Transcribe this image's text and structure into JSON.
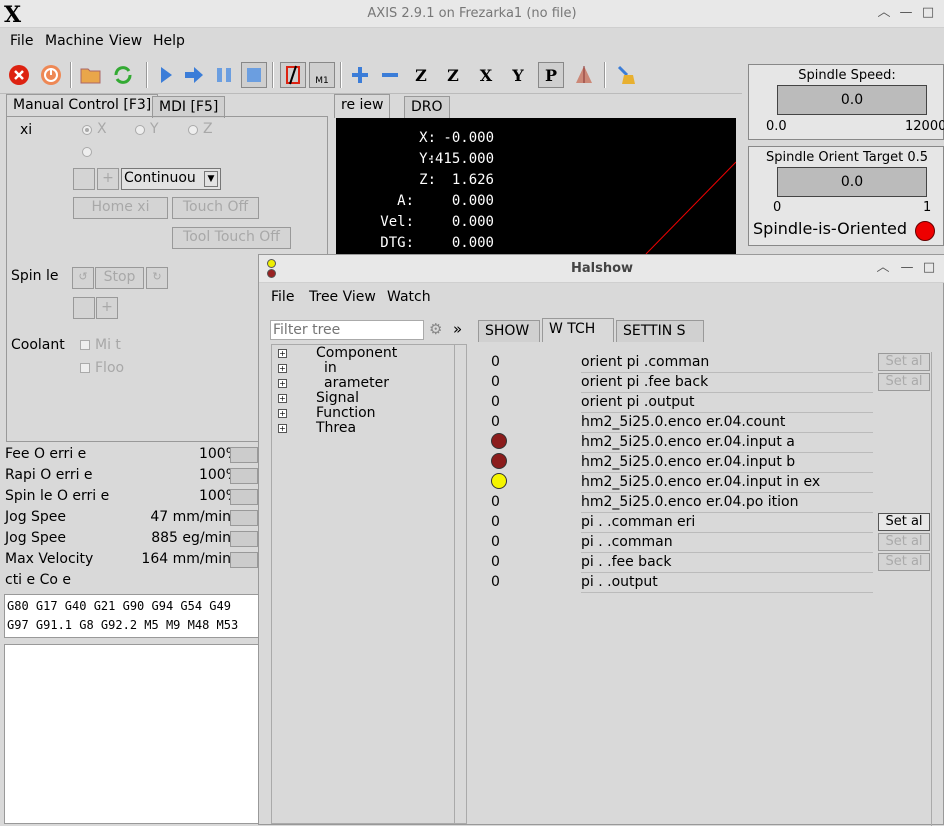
{
  "window": {
    "title": "AXIS 2.9.1 on Frezarka1 (no file)",
    "logo": "X"
  },
  "menu": [
    "File",
    "Machine",
    "View",
    "Help"
  ],
  "toolbar": {
    "icons": [
      "estop-icon",
      "power-icon",
      "open-icon",
      "reload-icon",
      "run-icon",
      "step-icon",
      "pause-icon",
      "stop-icon",
      "block-delete-icon",
      "optional-stop-icon",
      "zoom-in-icon",
      "zoom-out-icon",
      "view-z-icon",
      "view-z2-icon",
      "view-x-icon",
      "view-y-icon",
      "view-p-icon",
      "rotate-icon",
      "clear-icon"
    ],
    "optional_stop_label": "M1"
  },
  "tabs_left": [
    "Manual Control [F3]",
    "MDI [F5]"
  ],
  "manual": {
    "axis_label": "xi",
    "axes": [
      "X",
      "Y",
      "Z"
    ],
    "minus": "",
    "plus": "+",
    "jog_mode": "Continuou",
    "home_label": "Home   xi",
    "touch_off": "Touch Off",
    "tool_touch_off": "Tool Touch Off",
    "spindle_label": "Spin  le",
    "stop_label": "Stop",
    "coolant_label": "Coolant",
    "mist": "Mi  t",
    "flood": "Floo"
  },
  "overrides": [
    {
      "label": "Fee   O  erri   e",
      "value": "100%"
    },
    {
      "label": "Rapi   O  erri   e",
      "value": "100%"
    },
    {
      "label": "Spin  le O  erri   e",
      "value": "100%"
    },
    {
      "label": "Jog Spee",
      "value": "47 mm/min"
    },
    {
      "label": "Jog Spee",
      "value": "885   eg/min"
    },
    {
      "label": "Max Velocity",
      "value": "164 mm/min"
    }
  ],
  "active_codes": {
    "label": " cti  e    Co  e",
    "line1": "G80 G17 G40 G21 G90 G94 G54 G49",
    "line2": "G97 G91.1 G8 G92.2 M5 M9 M48 M53"
  },
  "tabs_view": [
    "re  iew",
    "DRO"
  ],
  "dro": [
    {
      "axis": "X:",
      "value": "-0.000"
    },
    {
      "axis": "Y:",
      "value": "-415.000"
    },
    {
      "axis": "Z:",
      "value": "1.626"
    },
    {
      "axis": "A:",
      "value": "0.000"
    },
    {
      "axis": "Vel:",
      "value": "0.000"
    },
    {
      "axis": "DTG:",
      "value": "0.000"
    }
  ],
  "spindle_speed": {
    "title": "Spindle Speed:",
    "value": "0.0",
    "min": "0.0",
    "max": "12000"
  },
  "spindle_orient": {
    "title": "Spindle Orient Target 0.5",
    "value": "0.0",
    "min": "0",
    "max": "1",
    "oriented_label": "Spindle-is-Oriented",
    "led_color": "#ee0000"
  },
  "halshow": {
    "title": "Halshow",
    "menu": [
      "File",
      "Tree View",
      "Watch"
    ],
    "filter_placeholder": "Filter tree",
    "more": "»",
    "tabs": [
      "SHOW",
      "W  TCH",
      "SETTIN  S"
    ],
    "tree": [
      "Component",
      "in",
      "arameter",
      "Signal",
      "Function",
      "Threa"
    ],
    "watch": [
      {
        "value": "0",
        "name": "orient pi  .comman",
        "set": "Set   al",
        "set_enabled": false,
        "led": ""
      },
      {
        "value": "0",
        "name": "orient pi  .fee  back",
        "set": "Set   al",
        "set_enabled": false,
        "led": ""
      },
      {
        "value": "0",
        "name": "orient pi  .output",
        "set": "",
        "set_enabled": false,
        "led": ""
      },
      {
        "value": "0",
        "name": "hm2_5i25.0.enco   er.04.count",
        "set": "",
        "set_enabled": false,
        "led": ""
      },
      {
        "value": "",
        "name": "hm2_5i25.0.enco   er.04.input a",
        "set": "",
        "set_enabled": false,
        "led": "#8b1c1c"
      },
      {
        "value": "",
        "name": "hm2_5i25.0.enco   er.04.input b",
        "set": "",
        "set_enabled": false,
        "led": "#8b1c1c"
      },
      {
        "value": "",
        "name": "hm2_5i25.0.enco   er.04.input in  ex",
        "set": "",
        "set_enabled": false,
        "led": "#f5f500"
      },
      {
        "value": "0",
        "name": "hm2_5i25.0.enco   er.04.po  ition",
        "set": "",
        "set_enabled": false,
        "led": ""
      },
      {
        "value": "0",
        "name": "pi  .  .comman     eri",
        "set": "Set   al",
        "set_enabled": true,
        "led": ""
      },
      {
        "value": "0",
        "name": "pi  .  .comman",
        "set": "Set   al",
        "set_enabled": false,
        "led": ""
      },
      {
        "value": "0",
        "name": "pi  .  .fee  back",
        "set": "Set   al",
        "set_enabled": false,
        "led": ""
      },
      {
        "value": "0",
        "name": "pi  .  .output",
        "set": "",
        "set_enabled": false,
        "led": ""
      }
    ]
  }
}
